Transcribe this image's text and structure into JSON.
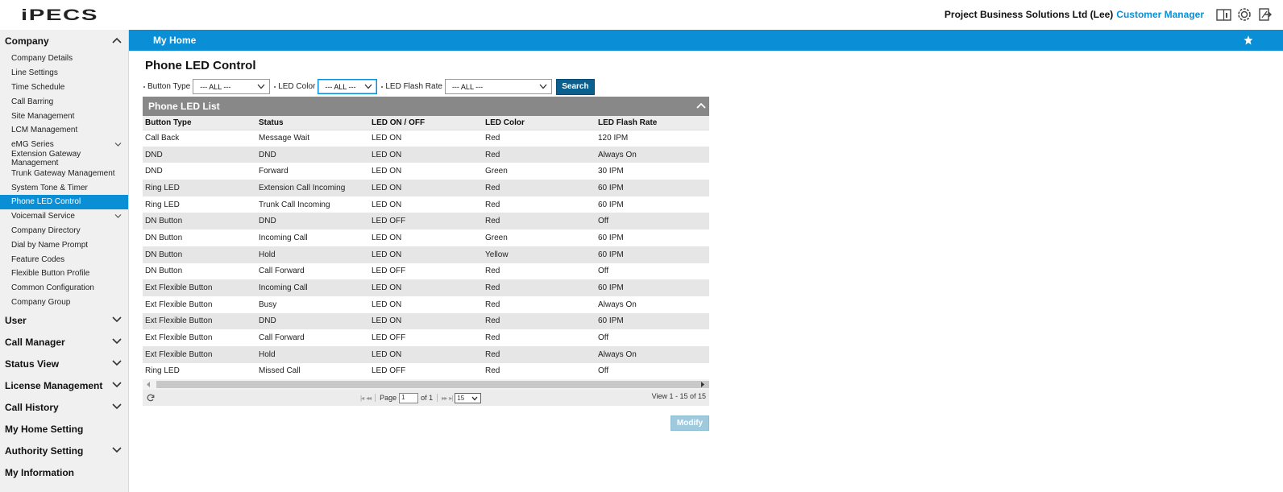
{
  "header": {
    "logo": "iPECS",
    "company_name": "Project Business Solutions Ltd (Lee)",
    "role": "Customer Manager",
    "icons": [
      "manual-icon",
      "settings-icon",
      "logout-icon"
    ]
  },
  "sidebar": {
    "company": {
      "label": "Company",
      "items": [
        {
          "label": "Company Details"
        },
        {
          "label": "Line Settings"
        },
        {
          "label": "Time Schedule"
        },
        {
          "label": "Call Barring"
        },
        {
          "label": "Site Management"
        },
        {
          "label": "LCM Management"
        },
        {
          "label": "eMG Series",
          "expandable": true
        },
        {
          "label": "Extension Gateway Management"
        },
        {
          "label": "Trunk Gateway Management"
        },
        {
          "label": "System Tone & Timer"
        },
        {
          "label": "Phone LED Control",
          "active": true
        },
        {
          "label": "Voicemail Service",
          "expandable": true
        },
        {
          "label": "Company Directory"
        },
        {
          "label": "Dial by Name Prompt"
        },
        {
          "label": "Feature Codes"
        },
        {
          "label": "Flexible Button Profile"
        },
        {
          "label": "Common Configuration"
        },
        {
          "label": "Company Group"
        }
      ]
    },
    "categories": [
      {
        "label": "User"
      },
      {
        "label": "Call Manager"
      },
      {
        "label": "Status View"
      },
      {
        "label": "License Management"
      },
      {
        "label": "Call History"
      },
      {
        "label": "My Home Setting"
      },
      {
        "label": "Authority Setting"
      },
      {
        "label": "My Information"
      }
    ]
  },
  "topnav": {
    "title": "My Home"
  },
  "page": {
    "title": "Phone LED Control"
  },
  "filters": {
    "button_type": {
      "label": "Button Type",
      "value": "--- ALL ---"
    },
    "led_color": {
      "label": "LED Color",
      "value": "--- ALL ---"
    },
    "led_flash_rate": {
      "label": "LED Flash Rate",
      "value": "--- ALL ---"
    },
    "search_label": "Search"
  },
  "grid": {
    "caption": "Phone LED List",
    "columns": [
      "Button Type",
      "Status",
      "LED ON / OFF",
      "LED Color",
      "LED Flash Rate"
    ],
    "rows": [
      [
        "Call Back",
        "Message Wait",
        "LED ON",
        "Red",
        "120 IPM"
      ],
      [
        "DND",
        "DND",
        "LED ON",
        "Red",
        "Always On"
      ],
      [
        "DND",
        "Forward",
        "LED ON",
        "Green",
        "30 IPM"
      ],
      [
        "Ring LED",
        "Extension Call Incoming",
        "LED ON",
        "Red",
        "60 IPM"
      ],
      [
        "Ring LED",
        "Trunk Call Incoming",
        "LED ON",
        "Red",
        "60 IPM"
      ],
      [
        "DN Button",
        "DND",
        "LED OFF",
        "Red",
        "Off"
      ],
      [
        "DN Button",
        "Incoming Call",
        "LED ON",
        "Green",
        "60 IPM"
      ],
      [
        "DN Button",
        "Hold",
        "LED ON",
        "Yellow",
        "60 IPM"
      ],
      [
        "DN Button",
        "Call Forward",
        "LED OFF",
        "Red",
        "Off"
      ],
      [
        "Ext Flexible Button",
        "Incoming Call",
        "LED ON",
        "Red",
        "60 IPM"
      ],
      [
        "Ext Flexible Button",
        "Busy",
        "LED ON",
        "Red",
        "Always On"
      ],
      [
        "Ext Flexible Button",
        "DND",
        "LED ON",
        "Red",
        "60 IPM"
      ],
      [
        "Ext Flexible Button",
        "Call Forward",
        "LED OFF",
        "Red",
        "Off"
      ],
      [
        "Ext Flexible Button",
        "Hold",
        "LED ON",
        "Red",
        "Always On"
      ],
      [
        "Ring LED",
        "Missed Call",
        "LED OFF",
        "Red",
        "Off"
      ]
    ],
    "pager": {
      "page_label": "Page",
      "page_value": "1",
      "of_label": "of 1",
      "page_size": "15",
      "view_info": "View 1 - 15 of 15"
    }
  },
  "actions": {
    "modify_label": "Modify"
  },
  "colors": {
    "accent": "#0a8fd6",
    "search_button": "#0a5f8f",
    "modify_button_disabled": "#9fc9dd",
    "grid_caption": "#888888"
  }
}
